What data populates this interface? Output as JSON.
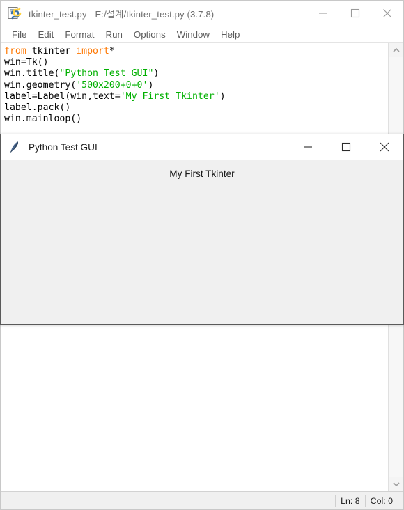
{
  "idle_window": {
    "icon": "idle-file-icon",
    "title": "tkinter_test.py - E:/설계/tkinter_test.py (3.7.8)",
    "controls": {
      "minimize": "minimize-icon",
      "maximize": "maximize-icon",
      "close": "close-icon"
    },
    "menubar": [
      {
        "label": "File"
      },
      {
        "label": "Edit"
      },
      {
        "label": "Format"
      },
      {
        "label": "Run"
      },
      {
        "label": "Options"
      },
      {
        "label": "Window"
      },
      {
        "label": "Help"
      }
    ],
    "code": {
      "line1": {
        "kw1": "from",
        "plain1": " tkinter ",
        "kw2": "import",
        "plain2": "*"
      },
      "line2": "win=Tk()",
      "line3": {
        "pre": "win.title(",
        "str": "\"Python Test GUI\"",
        "post": ")"
      },
      "line4": {
        "pre": "win.geometry(",
        "str": "'500x200+0+0'",
        "post": ")"
      },
      "line5": {
        "pre": "label=Label(win,text=",
        "str": "'My First Tkinter'",
        "post": ")"
      },
      "line6": "label.pack()",
      "line7": "win.mainloop()"
    },
    "scrollbar": {
      "up_arrow": "chevron-up-icon",
      "down_arrow": "chevron-down-icon"
    },
    "statusbar": {
      "line": "Ln: 8",
      "column": "Col: 0"
    }
  },
  "tk_window": {
    "icon": "tkinter-feather-icon",
    "title": "Python Test GUI",
    "controls": {
      "minimize": "minimize-icon",
      "maximize": "maximize-icon",
      "close": "close-icon"
    },
    "label_text": "My First Tkinter"
  },
  "colors": {
    "keyword": "#ff7700",
    "string": "#00b000",
    "text": "#000000",
    "title_inactive": "#6e6e6e",
    "window_chrome": "#f0f0f0"
  }
}
